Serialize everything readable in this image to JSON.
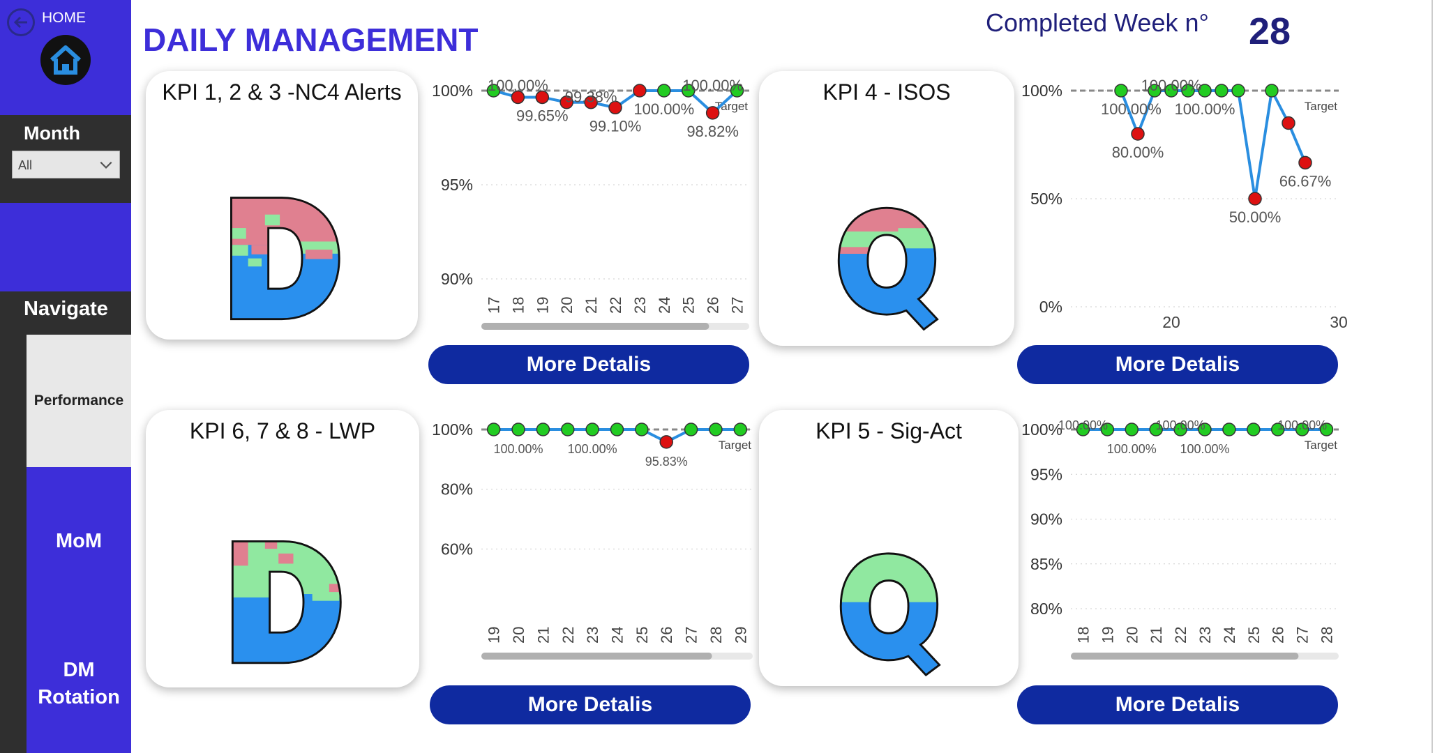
{
  "sidebar": {
    "home_label": "HOME",
    "month_label": "Month",
    "month_value": "All",
    "navigate_label": "Navigate",
    "nav_items": [
      "Performance",
      "MoM",
      "DM Rotation"
    ],
    "dm_line1": "DM",
    "dm_line2": "Rotation"
  },
  "header": {
    "title": "DAILY MANAGEMENT",
    "completed_label": "Completed Week n°",
    "week_number": "28"
  },
  "kpis": [
    {
      "title": "KPI 1, 2 & 3 -NC4 Alerts",
      "letter": "D",
      "button": "More Detalis"
    },
    {
      "title": "KPI 4 - ISOS",
      "letter": "Q",
      "button": "More Detalis"
    },
    {
      "title": "KPI 6, 7 & 8  - LWP",
      "letter": "D",
      "button": "More Detalis"
    },
    {
      "title": "KPI 5 - Sig-Act",
      "letter": "Q",
      "button": "More Detalis"
    }
  ],
  "colors": {
    "sidebar_blue": "#3d2ed9",
    "title_blue": "#3d2ed9",
    "button_blue": "#0f2aa0",
    "line_blue": "#2a8ee0",
    "good_green": "#22cc22",
    "bad_red": "#dd1111",
    "letter_red": "#e08090",
    "letter_green": "#90e8a0",
    "letter_blue": "#2a90ee"
  },
  "chart_data": [
    {
      "type": "line",
      "x": [
        17,
        18,
        19,
        20,
        21,
        22,
        23,
        24,
        25,
        26,
        27
      ],
      "values": [
        100.0,
        99.65,
        99.65,
        99.38,
        99.38,
        99.1,
        100.0,
        100.0,
        100.0,
        98.82,
        100.0
      ],
      "status": [
        "g",
        "r",
        "r",
        "r",
        "r",
        "r",
        "r",
        "g",
        "g",
        "r",
        "g"
      ],
      "ylim": [
        90,
        100
      ],
      "yticks": [
        "90%",
        "95%",
        "100%"
      ],
      "data_labels": [
        {
          "x": 18,
          "y": 100.0,
          "text": "100.00%",
          "pos": "above"
        },
        {
          "x": 19,
          "y": 99.65,
          "text": "99.65%",
          "pos": "below"
        },
        {
          "x": 21,
          "y": 99.38,
          "text": "99.38%",
          "pos": "above"
        },
        {
          "x": 22,
          "y": 99.1,
          "text": "99.10%",
          "pos": "below"
        },
        {
          "x": 24,
          "y": 100.0,
          "text": "100.00%",
          "pos": "below"
        },
        {
          "x": 26,
          "y": 100.0,
          "text": "100.00%",
          "pos": "above"
        },
        {
          "x": 26,
          "y": 98.82,
          "text": "98.82%",
          "pos": "below"
        }
      ],
      "target": {
        "value": 100,
        "label": "Target"
      },
      "rotate_xticks": true,
      "scrollbar": true
    },
    {
      "type": "line",
      "x": [
        17,
        18,
        19,
        20,
        21,
        22,
        23,
        24,
        25,
        26,
        27,
        28
      ],
      "values": [
        100,
        80,
        100,
        100,
        100,
        100,
        100,
        100,
        50,
        100,
        85,
        66.67
      ],
      "status": [
        "g",
        "r",
        "g",
        "g",
        "g",
        "g",
        "g",
        "g",
        "r",
        "g",
        "r",
        "r"
      ],
      "ylim": [
        0,
        100
      ],
      "yticks": [
        "0%",
        "50%",
        "100%"
      ],
      "x_axis_range": [
        14,
        30
      ],
      "xticks_shown": [
        20,
        30
      ],
      "data_labels": [
        {
          "x": 17.6,
          "y": 100,
          "text": "100.00%",
          "pos": "below"
        },
        {
          "x": 20,
          "y": 100,
          "text": "100.00%",
          "pos": "above"
        },
        {
          "x": 22,
          "y": 100,
          "text": "100.00%",
          "pos": "below"
        },
        {
          "x": 18,
          "y": 80,
          "text": "80.00%",
          "pos": "below"
        },
        {
          "x": 25,
          "y": 50,
          "text": "50.00%",
          "pos": "below"
        },
        {
          "x": 28,
          "y": 66.67,
          "text": "66.67%",
          "pos": "below"
        }
      ],
      "target": {
        "value": 100,
        "label": "Target"
      },
      "rotate_xticks": false,
      "scrollbar": false
    },
    {
      "type": "line",
      "x": [
        19,
        20,
        21,
        22,
        23,
        24,
        25,
        26,
        27,
        28,
        29
      ],
      "values": [
        100,
        100,
        100,
        100,
        100,
        100,
        100,
        95.83,
        100,
        100,
        100
      ],
      "status": [
        "g",
        "g",
        "g",
        "g",
        "g",
        "g",
        "g",
        "r",
        "g",
        "g",
        "g"
      ],
      "ylim": [
        40,
        100
      ],
      "yticks": [
        "60%",
        "80%",
        "100%"
      ],
      "data_labels": [
        {
          "x": 20,
          "y": 100,
          "text": "100.00%",
          "pos": "below"
        },
        {
          "x": 23,
          "y": 100,
          "text": "100.00%",
          "pos": "below"
        },
        {
          "x": 26,
          "y": 95.83,
          "text": "95.83%",
          "pos": "below"
        }
      ],
      "target": {
        "value": 100,
        "label": "Target"
      },
      "rotate_xticks": true,
      "scrollbar": true
    },
    {
      "type": "line",
      "x": [
        18,
        19,
        20,
        21,
        22,
        23,
        24,
        25,
        26,
        27,
        28
      ],
      "values": [
        100,
        100,
        100,
        100,
        100,
        100,
        100,
        100,
        100,
        100,
        100
      ],
      "status": [
        "g",
        "g",
        "g",
        "g",
        "g",
        "g",
        "g",
        "g",
        "g",
        "g",
        "g"
      ],
      "ylim": [
        80,
        100
      ],
      "yticks": [
        "80%",
        "85%",
        "90%",
        "95%",
        "100%"
      ],
      "data_labels": [
        {
          "x": 18,
          "y": 100,
          "text": "100.00%",
          "pos": "above"
        },
        {
          "x": 20,
          "y": 100,
          "text": "100.00%",
          "pos": "below"
        },
        {
          "x": 22,
          "y": 100,
          "text": "100.00%",
          "pos": "above"
        },
        {
          "x": 23,
          "y": 100,
          "text": "100.00%",
          "pos": "below"
        },
        {
          "x": 27,
          "y": 100,
          "text": "100.00%",
          "pos": "above"
        }
      ],
      "target": {
        "value": 100,
        "label": "Target"
      },
      "rotate_xticks": true,
      "scrollbar": true
    }
  ]
}
